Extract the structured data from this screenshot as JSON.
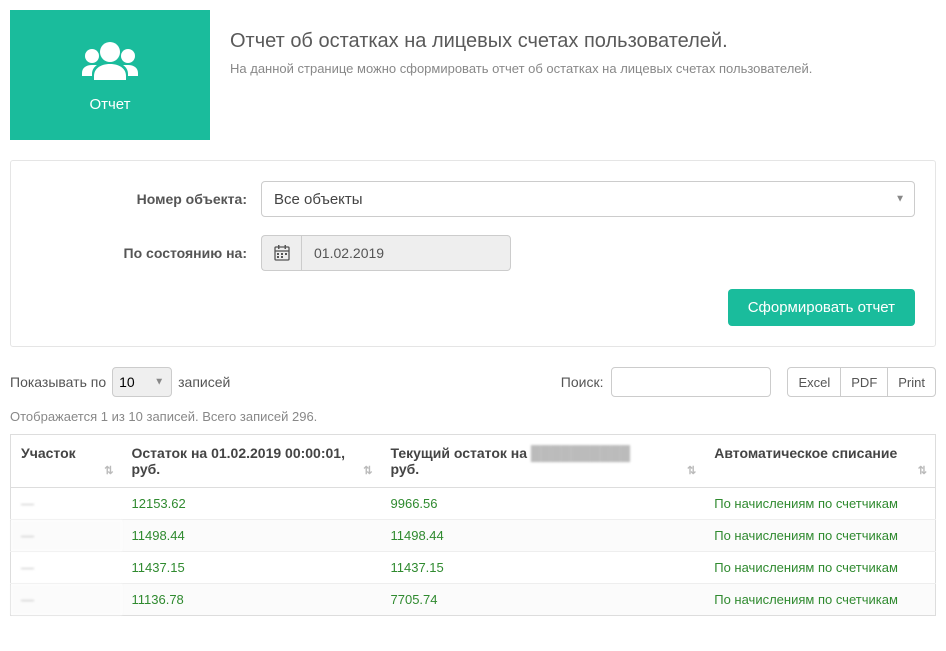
{
  "header": {
    "icon_label": "Отчет",
    "title": "Отчет об остатках на лицевых счетах пользователей.",
    "subtitle": "На данной странице можно сформировать отчет об остатках на лицевых счетах пользователей."
  },
  "filters": {
    "object_label": "Номер объекта:",
    "object_value": "Все объекты",
    "date_label": "По состоянию на:",
    "date_value": "01.02.2019",
    "submit_label": "Сформировать отчет"
  },
  "tableToolbar": {
    "show_prefix": "Показывать по",
    "page_length": "10",
    "show_suffix": "записей",
    "search_label": "Поиск:",
    "search_value": "",
    "export": {
      "excel": "Excel",
      "pdf": "PDF",
      "print": "Print"
    }
  },
  "tableInfo": "Отображается 1 из 10 записей. Всего записей 296.",
  "columns": {
    "c1": "Участок",
    "c2": "Остаток на 01.02.2019 00:00:01, руб.",
    "c3_prefix": "Текущий остаток на ",
    "c3_suffix": "руб.",
    "c4": "Автоматическое списание"
  },
  "rows": [
    {
      "plot": "—",
      "balance_at": "12153.62",
      "balance_now": "9966.56",
      "mode": "По начислениям по счетчикам"
    },
    {
      "plot": "—",
      "balance_at": "11498.44",
      "balance_now": "11498.44",
      "mode": "По начислениям по счетчикам"
    },
    {
      "plot": "—",
      "balance_at": "11437.15",
      "balance_now": "11437.15",
      "mode": "По начислениям по счетчикам"
    },
    {
      "plot": "—",
      "balance_at": "11136.78",
      "balance_now": "7705.74",
      "mode": "По начислениям по счетчикам"
    }
  ]
}
